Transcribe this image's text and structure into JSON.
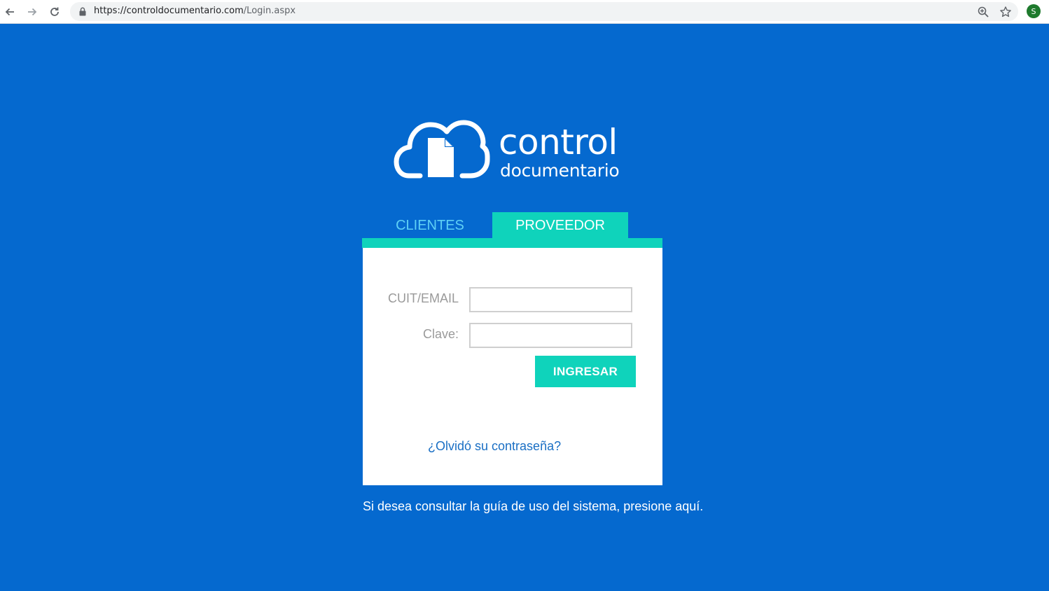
{
  "browser": {
    "url_host": "https://controldocumentario.com",
    "url_path": "/Login.aspx",
    "profile_initial": "S",
    "back_icon": "arrow-left-icon",
    "forward_icon": "arrow-right-icon",
    "reload_icon": "reload-icon",
    "lock_icon": "lock-icon",
    "zoom_icon": "zoom-icon",
    "star_icon": "star-icon"
  },
  "logo": {
    "word1": "control",
    "word2": "documentario",
    "icon": "cloud-document-icon"
  },
  "tabs": [
    {
      "label": "CLIENTES",
      "active": false
    },
    {
      "label": "PROVEEDOR",
      "active": true
    }
  ],
  "form": {
    "user_label": "CUIT/EMAIL",
    "user_value": "",
    "pass_label": "Clave:",
    "pass_value": "",
    "submit_label": "INGRESAR",
    "forgot_label": "¿Olvidó su contraseña?"
  },
  "guide_text": "Si desea consultar la guía de uso del sistema, presione aquí.",
  "colors": {
    "background": "#0569cf",
    "accent": "#0fd3bb",
    "inactive_tab": "#5fd0f5",
    "link": "#1a6fc4",
    "avatar": "#1e7a2d"
  }
}
